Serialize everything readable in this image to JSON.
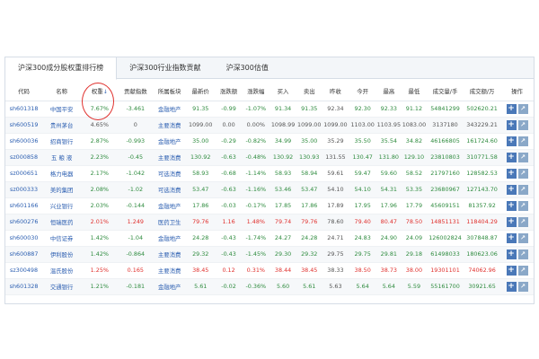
{
  "tabs": [
    {
      "label": "沪深300成分股权重排行榜",
      "active": true
    },
    {
      "label": "沪深300行业指数贡献",
      "active": false
    },
    {
      "label": "沪深300估值",
      "active": false
    }
  ],
  "columns": [
    "代码",
    "名称",
    "权重",
    "贡献指数",
    "所属板块",
    "最新价",
    "涨跌额",
    "涨跌幅",
    "买入",
    "卖出",
    "昨收",
    "今开",
    "最高",
    "最低",
    "成交量/手",
    "成交额/万",
    "操作"
  ],
  "sort_indicator": "↓",
  "rows": [
    {
      "code": "sh601318",
      "name": "中国平安",
      "weight": "7.67%",
      "contrib": "-3.461",
      "sector": "金融地产",
      "price": "91.35",
      "chg": "-0.99",
      "pct": "-1.07%",
      "bid": "91.34",
      "ask": "91.35",
      "prev": "92.34",
      "open": "92.30",
      "high": "92.33",
      "low": "91.12",
      "vol": "54841299",
      "amt": "502620.21",
      "dir": "down"
    },
    {
      "code": "sh600519",
      "name": "贵州茅台",
      "weight": "4.65%",
      "contrib": "0",
      "sector": "主要消费",
      "price": "1099.00",
      "chg": "0.00",
      "pct": "0.00%",
      "bid": "1098.99",
      "ask": "1099.00",
      "prev": "1099.00",
      "open": "1103.00",
      "high": "1103.95",
      "low": "1083.00",
      "vol": "3137180",
      "amt": "343229.21",
      "dir": "neutral"
    },
    {
      "code": "sh600036",
      "name": "招商银行",
      "weight": "2.87%",
      "contrib": "-0.993",
      "sector": "金融地产",
      "price": "35.00",
      "chg": "-0.29",
      "pct": "-0.82%",
      "bid": "34.99",
      "ask": "35.00",
      "prev": "35.29",
      "open": "35.50",
      "high": "35.54",
      "low": "34.82",
      "vol": "46166805",
      "amt": "161724.60",
      "dir": "down"
    },
    {
      "code": "sz000858",
      "name": "五 粮 液",
      "weight": "2.23%",
      "contrib": "-0.45",
      "sector": "主要消费",
      "price": "130.92",
      "chg": "-0.63",
      "pct": "-0.48%",
      "bid": "130.92",
      "ask": "130.93",
      "prev": "131.55",
      "open": "130.47",
      "high": "131.80",
      "low": "129.10",
      "vol": "23810803",
      "amt": "310771.58",
      "dir": "down"
    },
    {
      "code": "sz000651",
      "name": "格力电器",
      "weight": "2.17%",
      "contrib": "-1.042",
      "sector": "可选消费",
      "price": "58.93",
      "chg": "-0.68",
      "pct": "-1.14%",
      "bid": "58.93",
      "ask": "58.94",
      "prev": "59.61",
      "open": "59.47",
      "high": "59.60",
      "low": "58.52",
      "vol": "21797160",
      "amt": "128582.53",
      "dir": "down"
    },
    {
      "code": "sz000333",
      "name": "美的集团",
      "weight": "2.08%",
      "contrib": "-1.02",
      "sector": "可选消费",
      "price": "53.47",
      "chg": "-0.63",
      "pct": "-1.16%",
      "bid": "53.46",
      "ask": "53.47",
      "prev": "54.10",
      "open": "54.10",
      "high": "54.31",
      "low": "53.35",
      "vol": "23680967",
      "amt": "127143.70",
      "dir": "down"
    },
    {
      "code": "sh601166",
      "name": "兴业银行",
      "weight": "2.03%",
      "contrib": "-0.144",
      "sector": "金融地产",
      "price": "17.86",
      "chg": "-0.03",
      "pct": "-0.17%",
      "bid": "17.85",
      "ask": "17.86",
      "prev": "17.89",
      "open": "17.95",
      "high": "17.96",
      "low": "17.79",
      "vol": "45609151",
      "amt": "81357.92",
      "dir": "down"
    },
    {
      "code": "sh600276",
      "name": "恒瑞医药",
      "weight": "2.01%",
      "contrib": "1.249",
      "sector": "医药卫生",
      "price": "79.76",
      "chg": "1.16",
      "pct": "1.48%",
      "bid": "79.74",
      "ask": "79.76",
      "prev": "78.60",
      "open": "79.40",
      "high": "80.47",
      "low": "78.50",
      "vol": "14851131",
      "amt": "118404.29",
      "dir": "up"
    },
    {
      "code": "sh600030",
      "name": "中信证券",
      "weight": "1.42%",
      "contrib": "-1.04",
      "sector": "金融地产",
      "price": "24.28",
      "chg": "-0.43",
      "pct": "-1.74%",
      "bid": "24.27",
      "ask": "24.28",
      "prev": "24.71",
      "open": "24.83",
      "high": "24.90",
      "low": "24.09",
      "vol": "126002824",
      "amt": "307848.87",
      "dir": "down"
    },
    {
      "code": "sh600887",
      "name": "伊利股份",
      "weight": "1.42%",
      "contrib": "-0.864",
      "sector": "主要消费",
      "price": "29.32",
      "chg": "-0.43",
      "pct": "-1.45%",
      "bid": "29.30",
      "ask": "29.32",
      "prev": "29.75",
      "open": "29.75",
      "high": "29.81",
      "low": "29.18",
      "vol": "61498033",
      "amt": "180623.06",
      "dir": "down"
    },
    {
      "code": "sz300498",
      "name": "温氏股份",
      "weight": "1.25%",
      "contrib": "0.165",
      "sector": "主要消费",
      "price": "38.45",
      "chg": "0.12",
      "pct": "0.31%",
      "bid": "38.44",
      "ask": "38.45",
      "prev": "38.33",
      "open": "38.50",
      "high": "38.73",
      "low": "38.00",
      "vol": "19301101",
      "amt": "74062.96",
      "dir": "up"
    },
    {
      "code": "sh601328",
      "name": "交通银行",
      "weight": "1.21%",
      "contrib": "-0.181",
      "sector": "金融地产",
      "price": "5.61",
      "chg": "-0.02",
      "pct": "-0.36%",
      "bid": "5.60",
      "ask": "5.61",
      "prev": "5.63",
      "open": "5.64",
      "high": "5.64",
      "low": "5.59",
      "vol": "55161700",
      "amt": "30921.65",
      "dir": "down"
    }
  ]
}
